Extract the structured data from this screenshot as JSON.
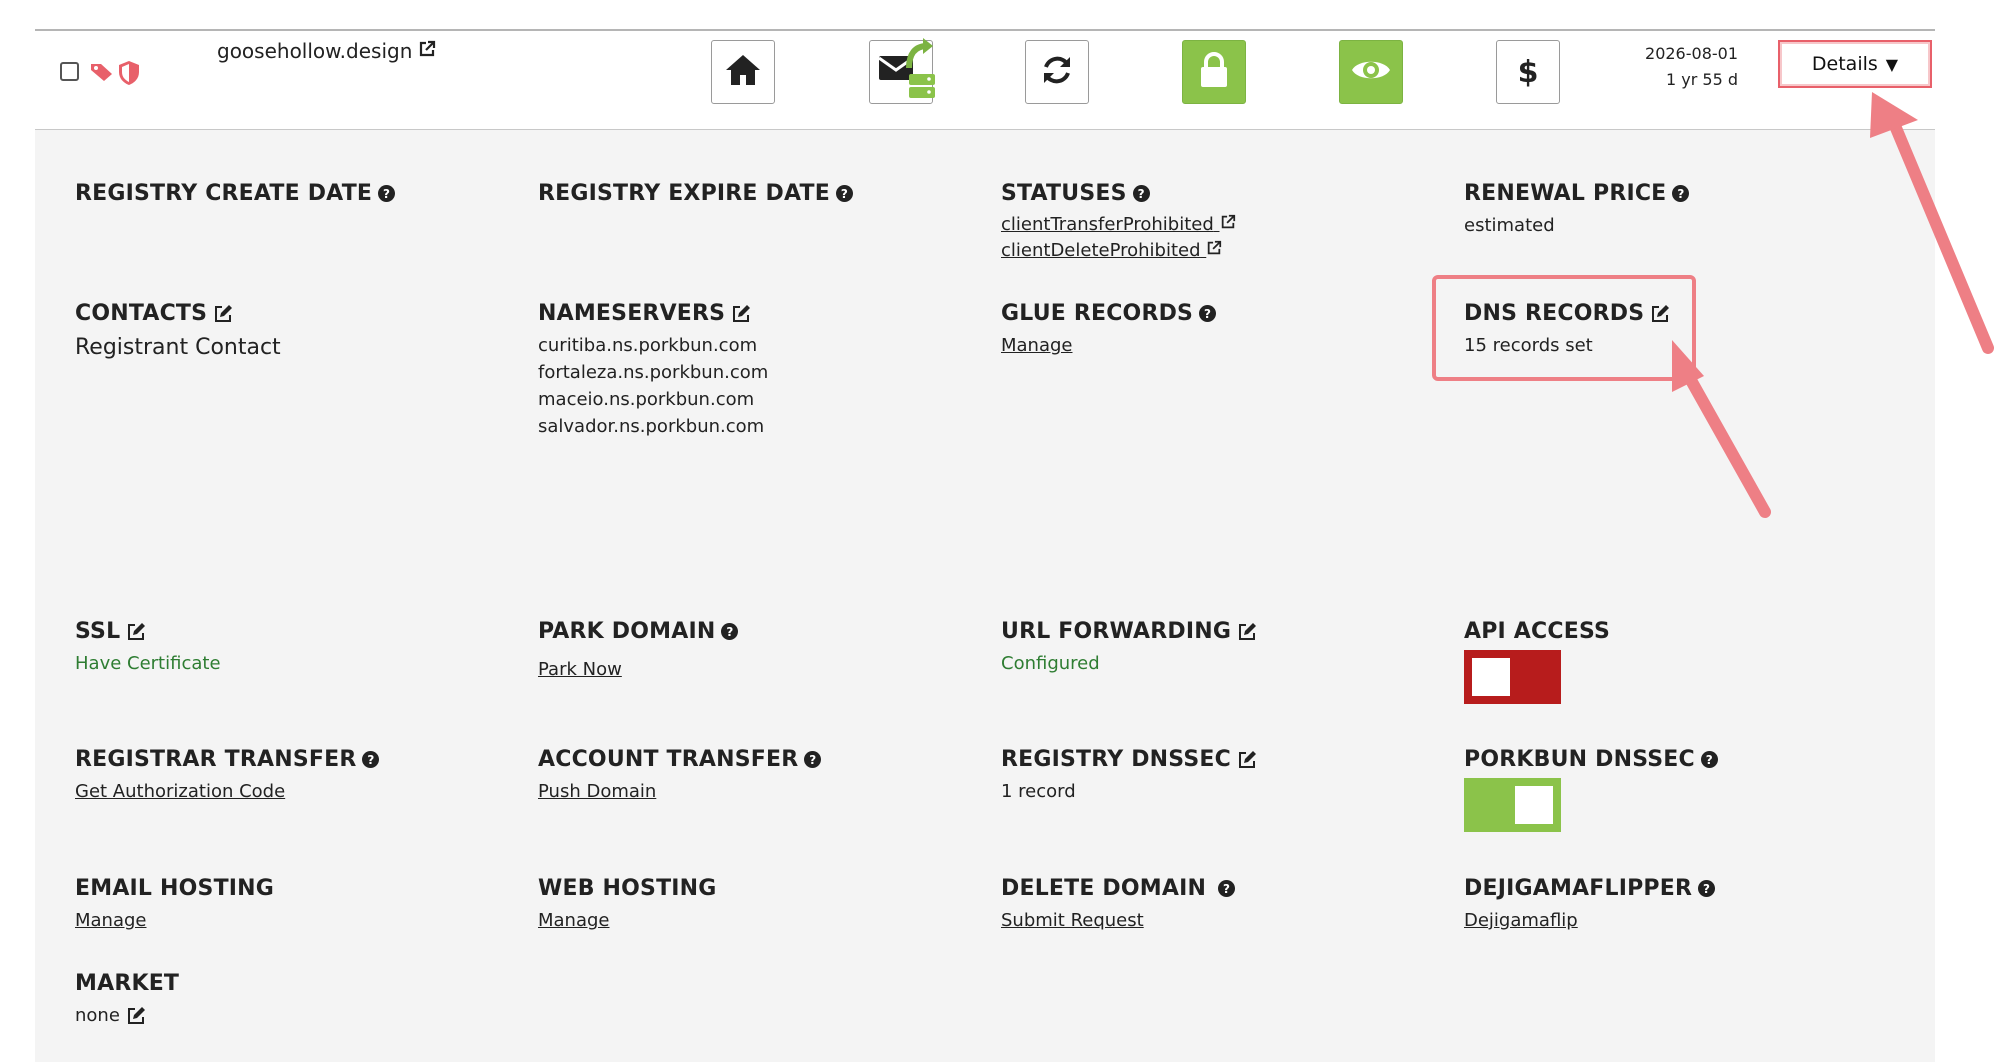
{
  "row": {
    "domain": "goosehollow.design",
    "date": "2026-08-01",
    "remaining": "1 yr 55 d",
    "details_label": "Details",
    "details_caret": "▼",
    "dollar": "$"
  },
  "colors": {
    "green": "#8bc34a",
    "red": "#b71c1c",
    "highlight": "#ee7f85"
  },
  "toolbar_icons": [
    "home-icon",
    "email-forward-icon",
    "refresh-icon",
    "lock-icon",
    "eye-icon",
    "dollar-icon"
  ],
  "fields": {
    "registry_create": {
      "label": "REGISTRY CREATE DATE"
    },
    "registry_expire": {
      "label": "REGISTRY EXPIRE DATE"
    },
    "statuses": {
      "label": "STATUSES",
      "items": [
        "clientTransferProhibited",
        "clientDeleteProhibited"
      ]
    },
    "renewal_price": {
      "label": "RENEWAL PRICE",
      "value": "estimated"
    },
    "contacts": {
      "label": "CONTACTS",
      "value": "Registrant Contact"
    },
    "nameservers": {
      "label": "NAMESERVERS",
      "items": [
        "curitiba.ns.porkbun.com",
        "fortaleza.ns.porkbun.com",
        "maceio.ns.porkbun.com",
        "salvador.ns.porkbun.com"
      ]
    },
    "glue_records": {
      "label": "GLUE RECORDS",
      "link": "Manage"
    },
    "dns_records": {
      "label": "DNS RECORDS",
      "value": "15 records set"
    },
    "ssl": {
      "label": "SSL",
      "value": "Have Certificate"
    },
    "park_domain": {
      "label": "PARK DOMAIN",
      "link": "Park Now"
    },
    "url_forwarding": {
      "label": "URL FORWARDING",
      "value": "Configured"
    },
    "api_access": {
      "label": "API ACCESS",
      "enabled": false
    },
    "registrar_transfer": {
      "label": "REGISTRAR TRANSFER",
      "link": "Get Authorization Code"
    },
    "account_transfer": {
      "label": "ACCOUNT TRANSFER",
      "link": "Push Domain"
    },
    "registry_dnssec": {
      "label": "REGISTRY DNSSEC",
      "value": "1 record"
    },
    "porkbun_dnssec": {
      "label": "PORKBUN DNSSEC",
      "enabled": true
    },
    "email_hosting": {
      "label": "EMAIL HOSTING",
      "link": "Manage"
    },
    "web_hosting": {
      "label": "WEB HOSTING",
      "link": "Manage"
    },
    "delete_domain": {
      "label": "DELETE DOMAIN",
      "link": "Submit Request"
    },
    "dejigamaflipper": {
      "label": "DEJIGAMAFLIPPER",
      "link": "Dejigamaflip"
    },
    "market": {
      "label": "MARKET",
      "value": "none"
    }
  }
}
